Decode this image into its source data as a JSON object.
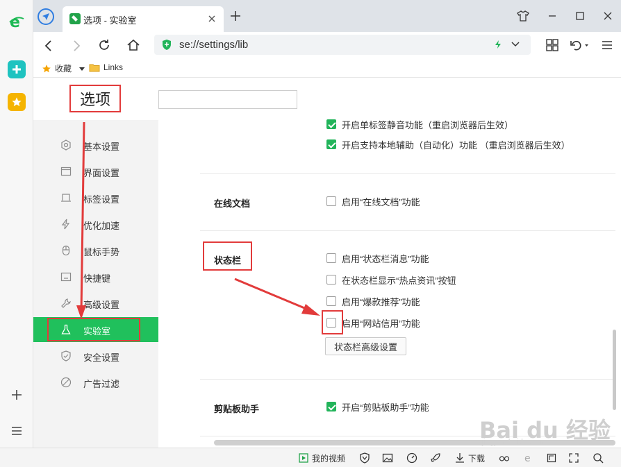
{
  "browser": {
    "tab_title": "选项 - 实验室",
    "address": "se://settings/lib",
    "bookmarks": [
      {
        "label": "收藏"
      },
      {
        "label": "Links"
      }
    ]
  },
  "page": {
    "title": "选项",
    "search_value": "",
    "sidebar": [
      {
        "label": "基本设置",
        "icon": "gear-icon"
      },
      {
        "label": "界面设置",
        "icon": "window-icon"
      },
      {
        "label": "标签设置",
        "icon": "tab-icon"
      },
      {
        "label": "优化加速",
        "icon": "lightning-icon"
      },
      {
        "label": "鼠标手势",
        "icon": "mouse-icon"
      },
      {
        "label": "快捷键",
        "icon": "keyboard-icon"
      },
      {
        "label": "高级设置",
        "icon": "wrench-icon"
      },
      {
        "label": "实验室",
        "icon": "flask-icon",
        "active": true
      },
      {
        "label": "安全设置",
        "icon": "shield-icon"
      },
      {
        "label": "广告过滤",
        "icon": "ban-icon"
      }
    ],
    "top_options": [
      {
        "label": "开启单标签静音功能（重启浏览器后生效）",
        "checked": true
      },
      {
        "label": "开启支持本地辅助（自动化）功能 （重启浏览器后生效）",
        "checked": true
      }
    ],
    "sections": {
      "online_docs": {
        "title": "在线文档",
        "options": [
          {
            "label": "启用“在线文档”功能",
            "checked": false
          }
        ]
      },
      "status_bar": {
        "title": "状态栏",
        "options": [
          {
            "label": "启用“状态栏消息”功能",
            "checked": false
          },
          {
            "label": "在状态栏显示“热点资讯”按钮",
            "checked": false
          },
          {
            "label": "启用“爆款推荐”功能",
            "checked": false
          },
          {
            "label": "启用“网站信用”功能",
            "checked": false
          }
        ],
        "advanced_button": "状态栏高级设置"
      },
      "clipboard": {
        "title": "剪贴板助手",
        "options": [
          {
            "label": "开启“剪贴板助手”功能",
            "checked": true
          }
        ]
      }
    }
  },
  "statusbar": {
    "video_label": "我的视频",
    "download_label": "下载"
  },
  "watermark": {
    "main": "Bai du 经验",
    "sub": "jingyan.baidu.com"
  },
  "colors": {
    "accent": "#20c05c",
    "annotation": "#e23b3b",
    "check": "#22b45a"
  }
}
